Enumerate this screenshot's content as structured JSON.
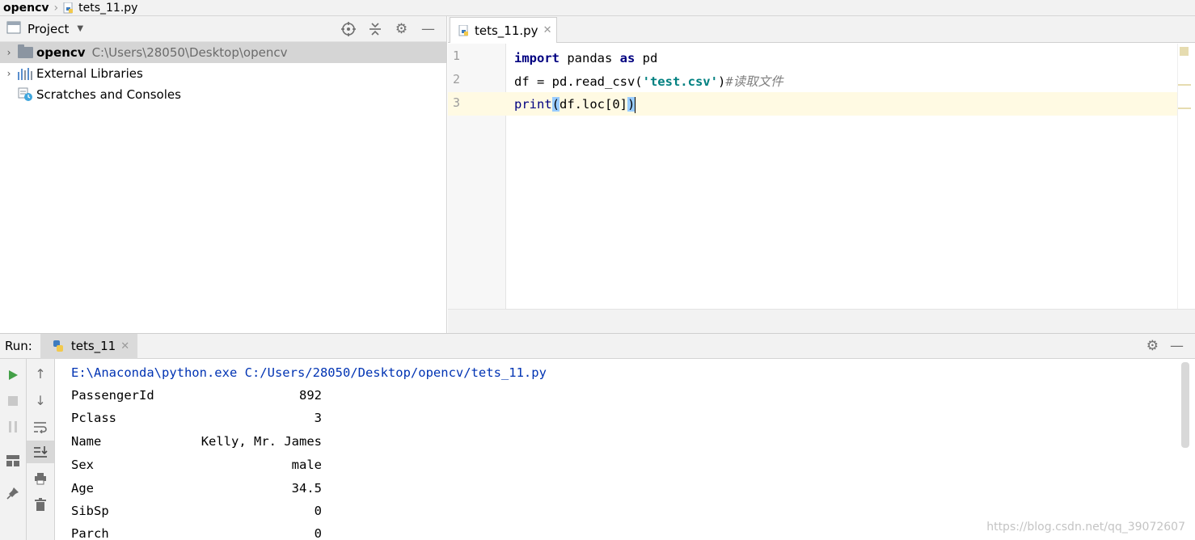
{
  "navbar": {
    "project": "opencv",
    "file": "tets_11.py"
  },
  "project_panel": {
    "title": "Project",
    "tree": [
      {
        "name": "opencv",
        "path": "C:\\Users\\28050\\Desktop\\opencv",
        "selected": true
      },
      {
        "name": "External Libraries"
      },
      {
        "name": "Scratches and Consoles"
      }
    ]
  },
  "editor": {
    "tab_label": "tets_11.py",
    "line_numbers": [
      "1",
      "2",
      "3"
    ],
    "code": {
      "l1_import": "import",
      "l1_mod": " pandas ",
      "l1_as": "as",
      "l1_alias": " pd",
      "l2_pre": "df = pd.read_csv(",
      "l2_str": "'test.csv'",
      "l2_close": ")",
      "l2_comment": "#读取文件",
      "l3_print": "print",
      "l3_open": "(",
      "l3_mid": "df.loc[0]",
      "l3_close": ")"
    }
  },
  "run_panel": {
    "label": "Run:",
    "tab_label": "tets_11",
    "command": "E:\\Anaconda\\python.exe C:/Users/28050/Desktop/opencv/tets_11.py",
    "output": [
      {
        "key": "PassengerId",
        "value": "892"
      },
      {
        "key": "Pclass",
        "value": "3"
      },
      {
        "key": "Name",
        "value": "Kelly, Mr. James"
      },
      {
        "key": "Sex",
        "value": "male"
      },
      {
        "key": "Age",
        "value": "34.5"
      },
      {
        "key": "SibSp",
        "value": "0"
      },
      {
        "key": "Parch",
        "value": "0"
      }
    ]
  },
  "watermark": "https://blog.csdn.net/qq_39072607",
  "colors": {
    "keyword": "#000080",
    "string": "#008080",
    "comment": "#808080",
    "caret_line": "#fffae3",
    "run_green": "#43a047"
  }
}
